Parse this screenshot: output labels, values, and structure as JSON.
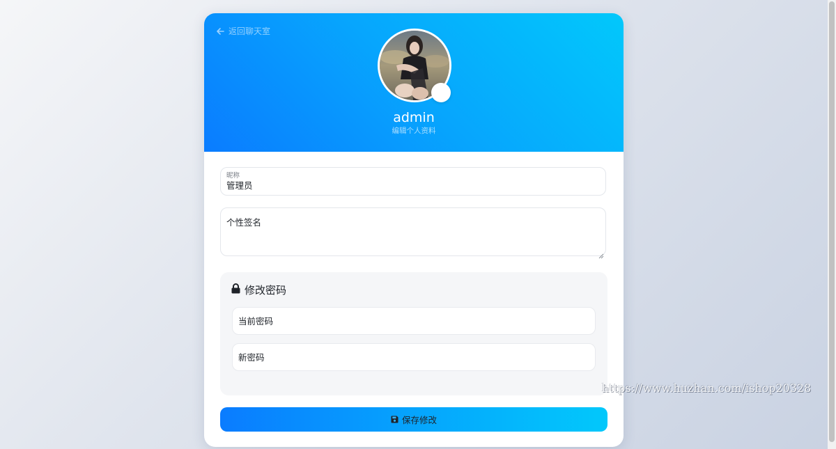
{
  "header": {
    "back_label": "返回聊天室",
    "username": "admin",
    "subtitle": "编辑个人资料"
  },
  "form": {
    "nickname_label": "昵称",
    "nickname_value": "管理员",
    "signature_placeholder": "个性签名"
  },
  "password": {
    "title": "修改密码",
    "current_placeholder": "当前密码",
    "new_placeholder": "新密码"
  },
  "actions": {
    "save_label": "保存修改"
  },
  "watermark": "https://www.huzhan.com/ishop20328",
  "icons": {
    "back": "arrow-left-icon",
    "lock": "lock-icon",
    "save": "floppy-disk-icon",
    "upload": "camera-icon"
  },
  "colors": {
    "accent_start": "#0a7cff",
    "accent_end": "#02c8fb"
  }
}
